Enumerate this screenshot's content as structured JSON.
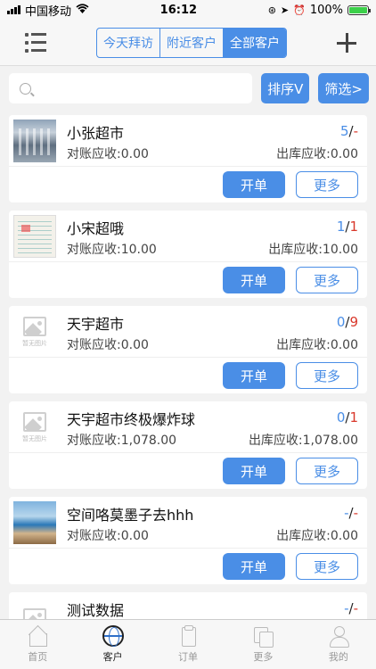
{
  "status_bar": {
    "carrier": "中国移动",
    "time": "16:12",
    "battery": "100%"
  },
  "header": {
    "segments": [
      {
        "label": "今天拜访",
        "active": false
      },
      {
        "label": "附近客户",
        "active": false
      },
      {
        "label": "全部客户",
        "active": true
      }
    ]
  },
  "toolbar": {
    "search_placeholder": "",
    "sort_label": "排序V",
    "filter_label": "筛选>"
  },
  "placeholder_text": "暂无图片",
  "customers": [
    {
      "name": "小张超市",
      "c1": "5",
      "sep": "/",
      "c2": "-",
      "recon": "对账应收:0.00",
      "outbound": "出库应收:0.00",
      "thumb": "market"
    },
    {
      "name": "小宋超哦",
      "c1": "1",
      "sep": "/",
      "c2": "1",
      "recon": "对账应收:10.00",
      "outbound": "出库应收:10.00",
      "thumb": "board"
    },
    {
      "name": "天宇超市",
      "c1": "0",
      "sep": "/",
      "c2": "9",
      "recon": "对账应收:0.00",
      "outbound": "出库应收:0.00",
      "thumb": "placeholder"
    },
    {
      "name": "天宇超市终极爆炸球",
      "c1": "0",
      "sep": "/",
      "c2": "1",
      "recon": "对账应收:1,078.00",
      "outbound": "出库应收:1,078.00",
      "thumb": "placeholder"
    },
    {
      "name": "空间咯莫墨子去hhh",
      "c1": "-",
      "sep": "/",
      "c2": "-",
      "recon": "对账应收:0.00",
      "outbound": "出库应收:0.00",
      "thumb": "coast"
    },
    {
      "name": "测试数据",
      "c1": "-",
      "sep": "/",
      "c2": "-",
      "recon": "",
      "outbound": "",
      "thumb": "placeholder"
    }
  ],
  "actions": {
    "open_label": "开单",
    "more_label": "更多"
  },
  "tabbar": {
    "items": [
      {
        "label": "首页",
        "icon": "home-icon"
      },
      {
        "label": "客户",
        "icon": "globe-icon",
        "active": true
      },
      {
        "label": "订单",
        "icon": "order-icon"
      },
      {
        "label": "更多",
        "icon": "more-icon"
      },
      {
        "label": "我的",
        "icon": "user-icon"
      }
    ]
  },
  "colors": {
    "accent": "#4a8ee6",
    "alert": "#d9382b"
  }
}
